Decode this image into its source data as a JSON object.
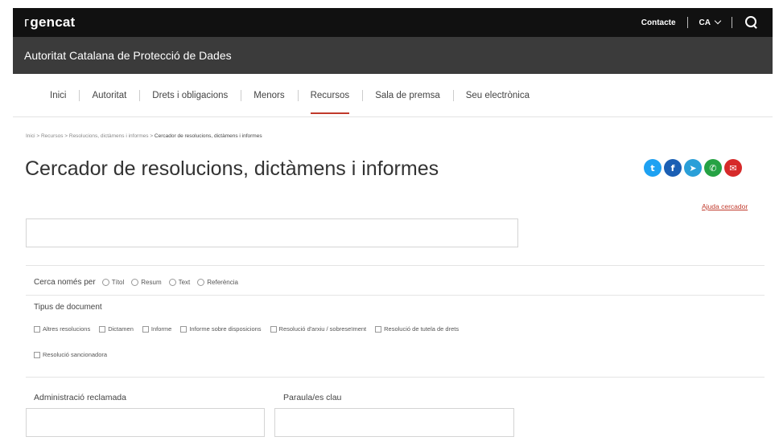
{
  "topbar": {
    "logo_mark": "г",
    "logo_text": "gencat",
    "contact": "Contacte",
    "language": "CA"
  },
  "org": {
    "name": "Autoritat Catalana de Protecció de Dades"
  },
  "nav": {
    "items": [
      {
        "label": "Inici"
      },
      {
        "label": "Autoritat"
      },
      {
        "label": "Drets i obligacions"
      },
      {
        "label": "Menors"
      },
      {
        "label": "Recursos",
        "active": true
      },
      {
        "label": "Sala de premsa"
      },
      {
        "label": "Seu electrònica"
      }
    ]
  },
  "breadcrumb": {
    "items": [
      "Inici",
      "Recursos",
      "Resolucions, dictàmens i informes"
    ],
    "separator": ">",
    "current": "Cercador de resolucions, dictàmens i informes"
  },
  "page": {
    "title": "Cercador de resolucions, dictàmens i informes",
    "help_link": "Ajuda cercador"
  },
  "social": [
    {
      "name": "twitter",
      "color": "#1da1f2",
      "glyph": "t"
    },
    {
      "name": "facebook",
      "color": "#1a5fb4",
      "glyph": "f"
    },
    {
      "name": "telegram",
      "color": "#2a9fd8",
      "glyph": "➤"
    },
    {
      "name": "whatsapp",
      "color": "#25a244",
      "glyph": "✆"
    },
    {
      "name": "email",
      "color": "#d62a2a",
      "glyph": "✉"
    }
  ],
  "search": {
    "value": "",
    "placeholder": "",
    "only_label": "Cerca només per",
    "only_options": [
      "Títol",
      "Resum",
      "Text",
      "Referència"
    ]
  },
  "doc_types": {
    "label": "Tipus de document",
    "options": [
      "Altres resolucions",
      "Dictamen",
      "Informe",
      "Informe sobre disposicions",
      "Resolució d'arxiu / sobreseïment",
      "Resolució de tutela de drets",
      "Resolució sancionadora"
    ]
  },
  "filters": {
    "admin_label": "Administració reclamada",
    "admin_value": "",
    "keywords_label": "Paraula/es clau",
    "keywords_value": ""
  },
  "colors": {
    "accent": "#c0392b",
    "topbar": "#111111",
    "orgbar": "#3b3b3b"
  }
}
